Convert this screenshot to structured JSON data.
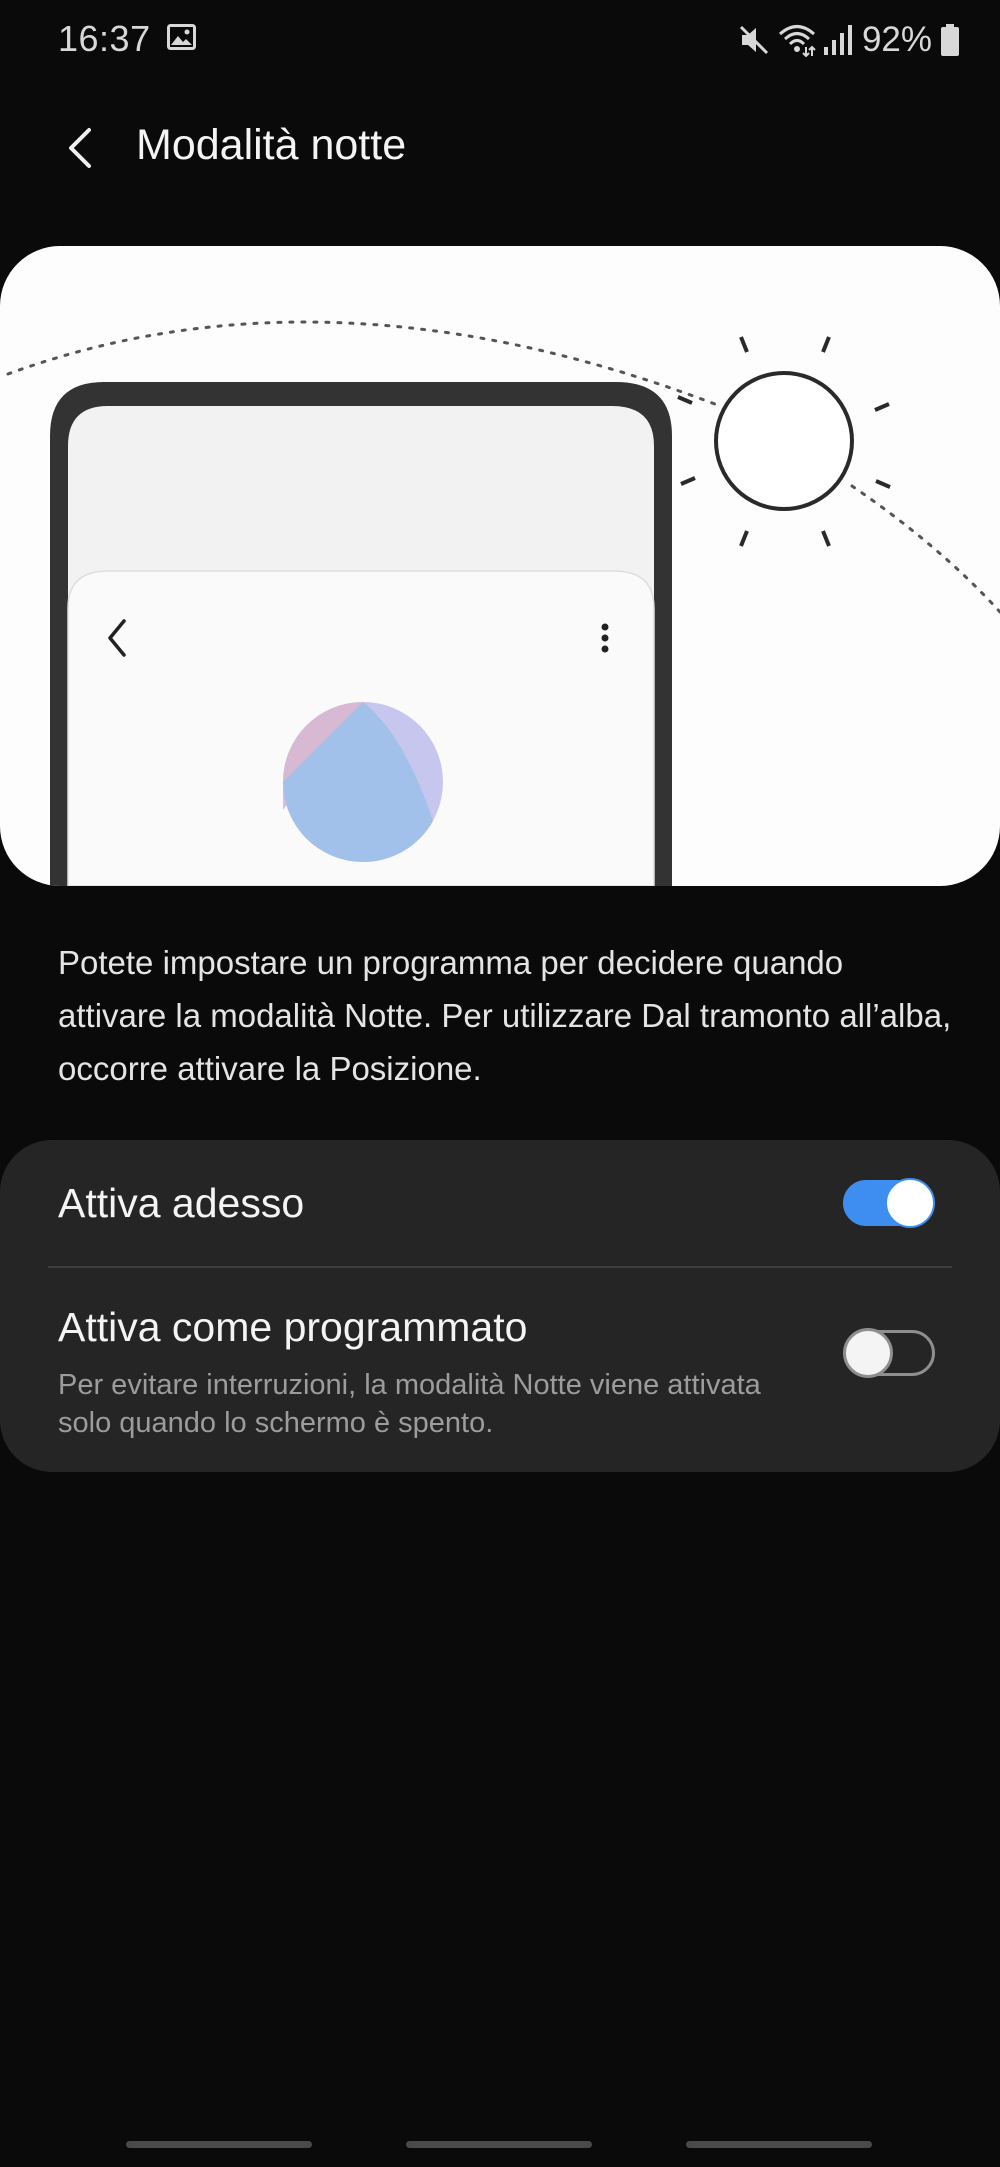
{
  "status_bar": {
    "time": "16:37",
    "battery_percent": "92%",
    "icons": [
      "gallery-icon",
      "mute-icon",
      "wifi-icon",
      "signal-icon",
      "battery-icon"
    ]
  },
  "header": {
    "title": "Modalità notte",
    "back_icon": "back-arrow-icon"
  },
  "description": "Potete impostare un programma per decidere quando attivare la modalità Notte. Per utilizzare Dal tramonto all’alba, occorre attivare la Posizione.",
  "settings": {
    "turn_on_now": {
      "label": "Attiva adesso",
      "enabled": true
    },
    "scheduled": {
      "label": "Attiva come programmato",
      "description": "Per evitare interruzioni, la modalità Notte viene attivata solo quando lo schermo è spento.",
      "enabled": false
    }
  },
  "colors": {
    "background": "#0a0a0a",
    "card": "#252525",
    "accent": "#3e8ef2",
    "illustration_background": "#fdfdfd"
  }
}
